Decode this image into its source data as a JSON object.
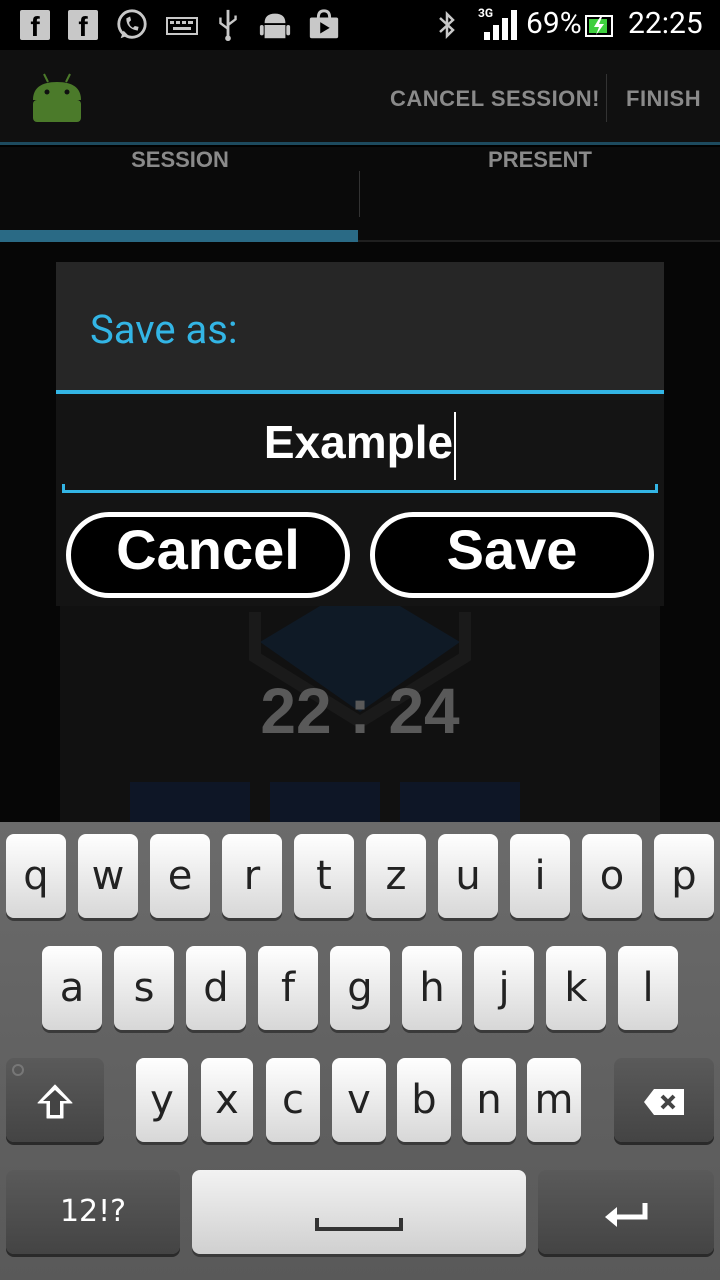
{
  "status_bar": {
    "network": "3G",
    "battery": "69%",
    "time": "22:25"
  },
  "action_bar": {
    "cancel_label": "CANCEL SESSION!",
    "finish_label": "FINISH"
  },
  "tabs": [
    {
      "label": "SESSION",
      "selected": true
    },
    {
      "label": "PRESENT",
      "selected": false
    }
  ],
  "background": {
    "timer": "22 : 24"
  },
  "dialog": {
    "title": "Save as:",
    "input_value": "Example",
    "cancel_label": "Cancel",
    "save_label": "Save"
  },
  "keyboard": {
    "row1": [
      "q",
      "w",
      "e",
      "r",
      "t",
      "z",
      "u",
      "i",
      "o",
      "p"
    ],
    "row2": [
      "a",
      "s",
      "d",
      "f",
      "g",
      "h",
      "j",
      "k",
      "l"
    ],
    "row3": [
      "y",
      "x",
      "c",
      "v",
      "b",
      "n",
      "m"
    ],
    "symbols_label": "12!?"
  },
  "colors": {
    "accent": "#33b5e5",
    "tab_indicator": "#2a6a85"
  }
}
